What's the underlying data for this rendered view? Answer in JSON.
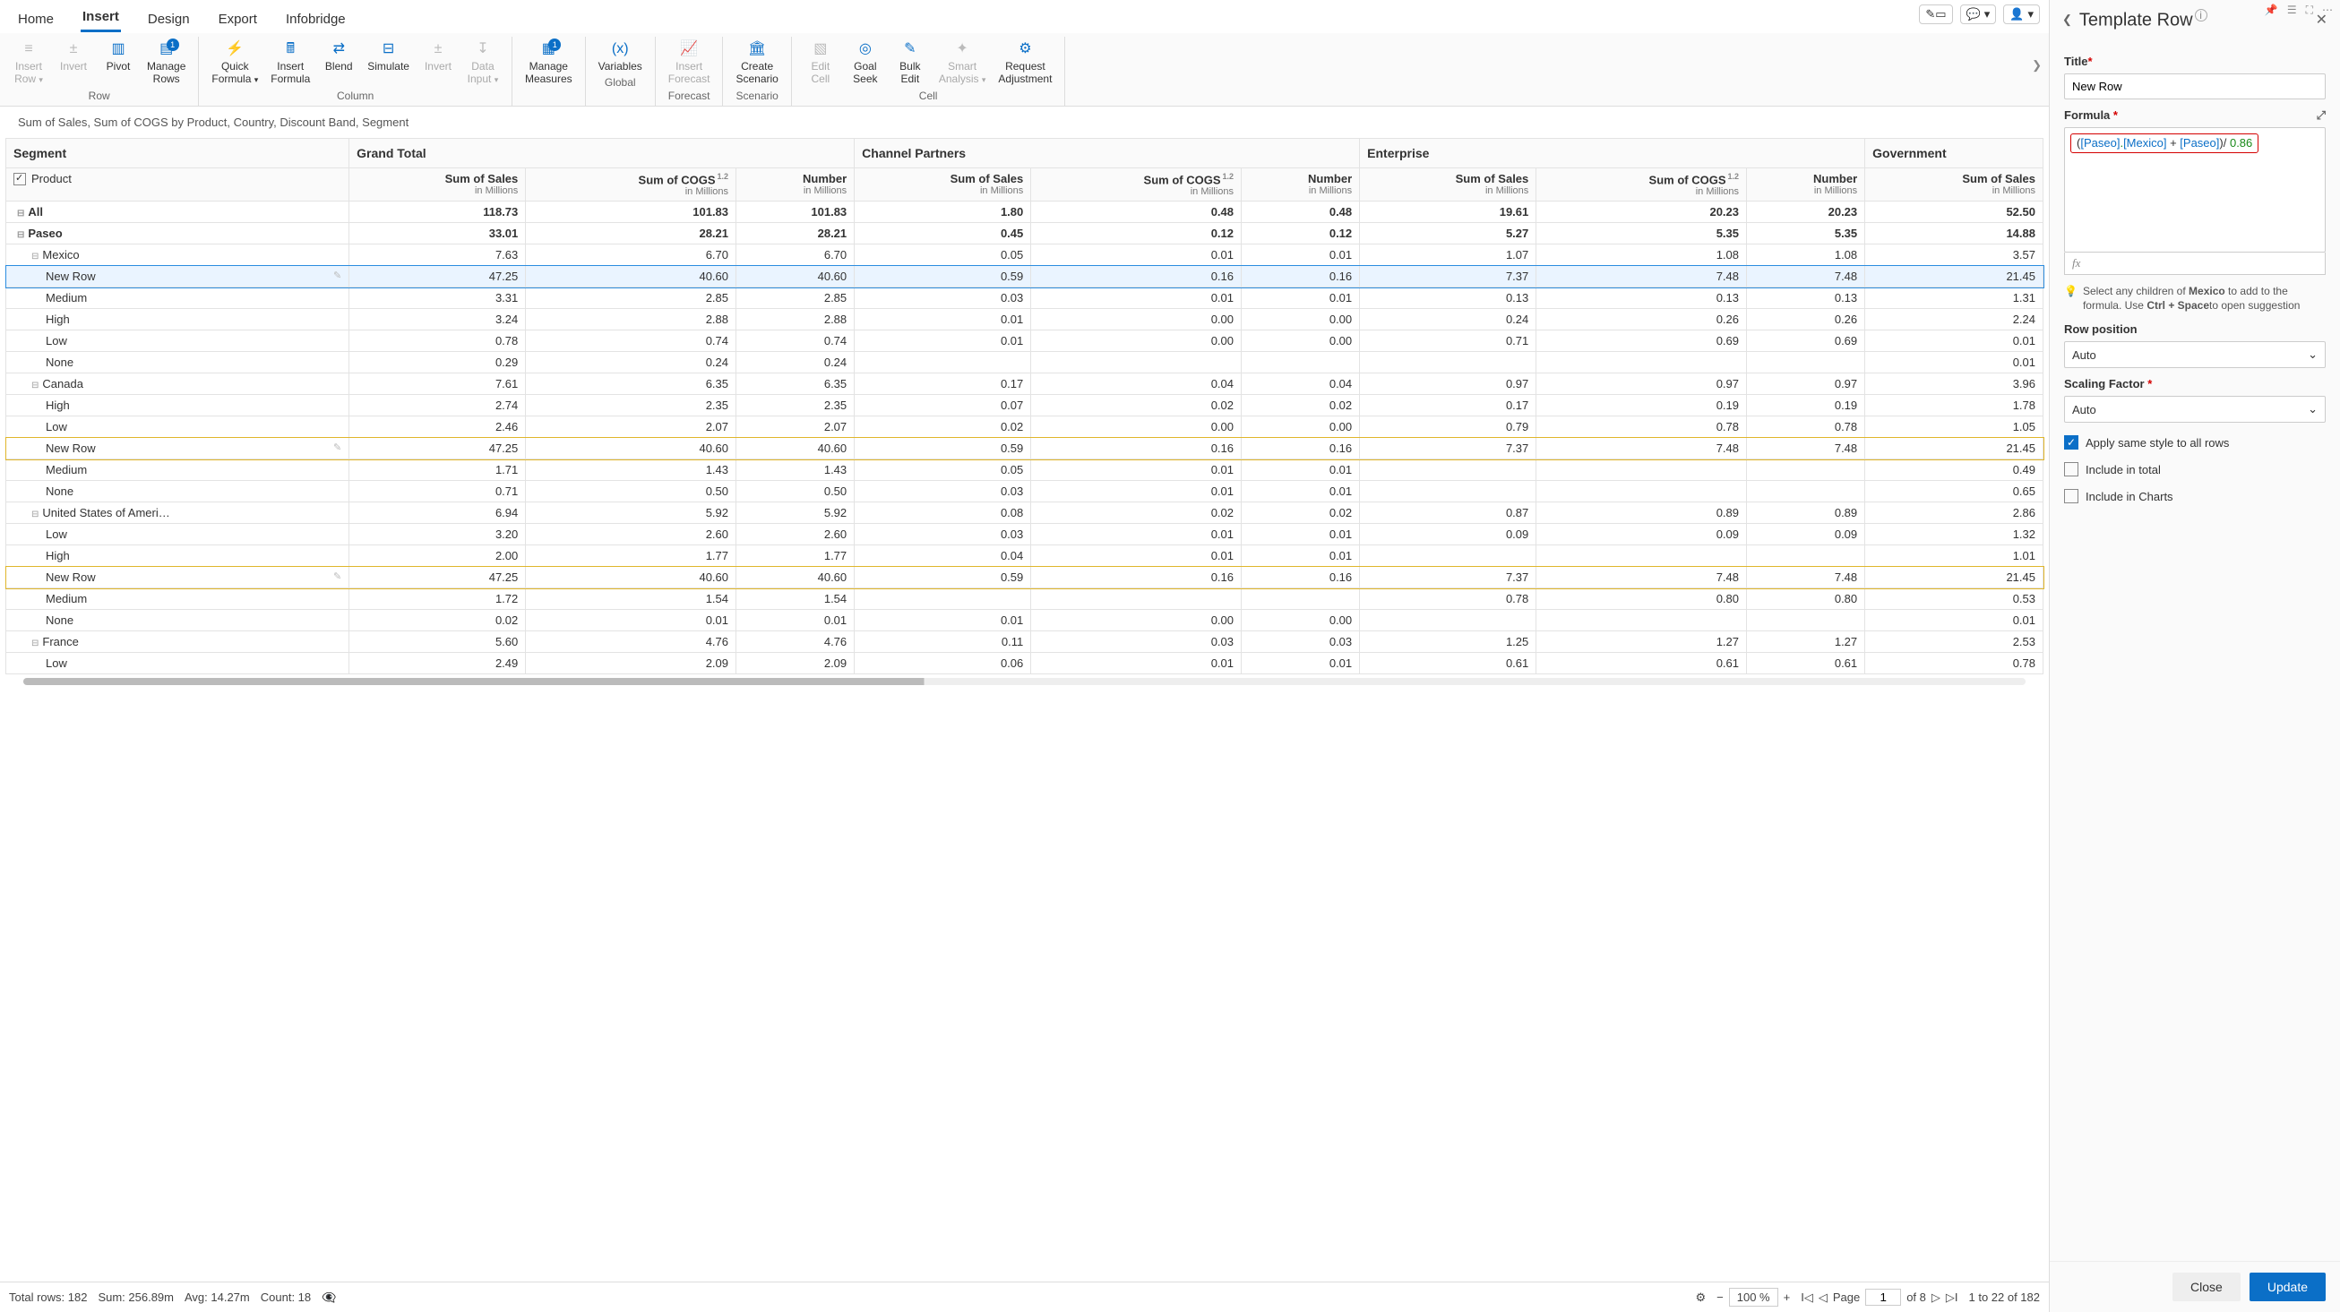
{
  "tabs": [
    "Home",
    "Insert",
    "Design",
    "Export",
    "Infobridge"
  ],
  "active_tab": 1,
  "ribbon_groups": [
    {
      "label": "Row",
      "buttons": [
        {
          "name": "insert-row",
          "label": "Insert\nRow",
          "icon": "≡",
          "disabled": true,
          "chevron": true
        },
        {
          "name": "invert-row",
          "label": "Invert",
          "icon": "±",
          "disabled": true
        },
        {
          "name": "pivot",
          "label": "Pivot",
          "icon": "▥"
        },
        {
          "name": "manage-rows",
          "label": "Manage\nRows",
          "icon": "▤",
          "badge": true
        }
      ]
    },
    {
      "label": "Column",
      "buttons": [
        {
          "name": "quick-formula",
          "label": "Quick\nFormula",
          "icon": "⚡",
          "chevron": true
        },
        {
          "name": "insert-formula",
          "label": "Insert\nFormula",
          "icon": "🖩"
        },
        {
          "name": "blend",
          "label": "Blend",
          "icon": "⇄"
        },
        {
          "name": "simulate",
          "label": "Simulate",
          "icon": "⊟"
        },
        {
          "name": "invert-col",
          "label": "Invert",
          "icon": "±",
          "disabled": true
        },
        {
          "name": "data-input",
          "label": "Data\nInput",
          "icon": "↧",
          "disabled": true,
          "chevron": true
        }
      ]
    },
    {
      "label": "",
      "buttons": [
        {
          "name": "manage-measures",
          "label": "Manage\nMeasures",
          "icon": "▦",
          "badge": true
        }
      ]
    },
    {
      "label": "Global",
      "buttons": [
        {
          "name": "variables",
          "label": "Variables",
          "icon": "(x)"
        }
      ]
    },
    {
      "label": "Forecast",
      "buttons": [
        {
          "name": "insert-forecast",
          "label": "Insert\nForecast",
          "icon": "📈",
          "disabled": true
        }
      ]
    },
    {
      "label": "Scenario",
      "buttons": [
        {
          "name": "create-scenario",
          "label": "Create\nScenario",
          "icon": "🏛"
        }
      ]
    },
    {
      "label": "Cell",
      "buttons": [
        {
          "name": "edit-cell",
          "label": "Edit\nCell",
          "icon": "▧",
          "disabled": true
        },
        {
          "name": "goal-seek",
          "label": "Goal\nSeek",
          "icon": "◎"
        },
        {
          "name": "bulk-edit",
          "label": "Bulk\nEdit",
          "icon": "✎"
        },
        {
          "name": "smart-analysis",
          "label": "Smart\nAnalysis",
          "icon": "✦",
          "disabled": true,
          "chevron": true
        },
        {
          "name": "request-adjustment",
          "label": "Request\nAdjustment",
          "icon": "⚙"
        }
      ]
    }
  ],
  "breadcrumb": "Sum of Sales, Sum of COGS by Product, Country, Discount Band, Segment",
  "segment_header": "Segment",
  "product_header": "Product",
  "column_groups": [
    "Grand Total",
    "Channel Partners",
    "Enterprise",
    "Government"
  ],
  "measure_cols": [
    {
      "main": "Sum of Sales",
      "sub": "in Millions"
    },
    {
      "main": "Sum of COGS",
      "sub": "in Millions",
      "sup": "1.2"
    },
    {
      "main": "Number",
      "sub": "in Millions"
    }
  ],
  "gov_col": {
    "main": "Sum of Sales",
    "sub": "in Millions"
  },
  "rows": [
    {
      "label": "All",
      "indent": 0,
      "bold": true,
      "coll": true,
      "vals": [
        "118.73",
        "101.83",
        "101.83",
        "1.80",
        "0.48",
        "0.48",
        "19.61",
        "20.23",
        "20.23",
        "52.50"
      ]
    },
    {
      "label": "Paseo",
      "indent": 0,
      "bold": true,
      "coll": true,
      "vals": [
        "33.01",
        "28.21",
        "28.21",
        "0.45",
        "0.12",
        "0.12",
        "5.27",
        "5.35",
        "5.35",
        "14.88"
      ]
    },
    {
      "label": "Mexico",
      "indent": 1,
      "coll": true,
      "vals": [
        "7.63",
        "6.70",
        "6.70",
        "0.05",
        "0.01",
        "0.01",
        "1.07",
        "1.08",
        "1.08",
        "3.57"
      ]
    },
    {
      "label": "New Row",
      "indent": 2,
      "pencil": true,
      "rowstyle": "newrow-blue",
      "vals": [
        "47.25",
        "40.60",
        "40.60",
        "0.59",
        "0.16",
        "0.16",
        "7.37",
        "7.48",
        "7.48",
        "21.45"
      ]
    },
    {
      "label": "Medium",
      "indent": 2,
      "vals": [
        "3.31",
        "2.85",
        "2.85",
        "0.03",
        "0.01",
        "0.01",
        "0.13",
        "0.13",
        "0.13",
        "1.31"
      ]
    },
    {
      "label": "High",
      "indent": 2,
      "vals": [
        "3.24",
        "2.88",
        "2.88",
        "0.01",
        "0.00",
        "0.00",
        "0.24",
        "0.26",
        "0.26",
        "2.24"
      ]
    },
    {
      "label": "Low",
      "indent": 2,
      "vals": [
        "0.78",
        "0.74",
        "0.74",
        "0.01",
        "0.00",
        "0.00",
        "0.71",
        "0.69",
        "0.69",
        "0.01"
      ]
    },
    {
      "label": "None",
      "indent": 2,
      "vals": [
        "0.29",
        "0.24",
        "0.24",
        "",
        "",
        "",
        "",
        "",
        "",
        "0.01"
      ]
    },
    {
      "label": "Canada",
      "indent": 1,
      "coll": true,
      "vals": [
        "7.61",
        "6.35",
        "6.35",
        "0.17",
        "0.04",
        "0.04",
        "0.97",
        "0.97",
        "0.97",
        "3.96"
      ]
    },
    {
      "label": "High",
      "indent": 2,
      "vals": [
        "2.74",
        "2.35",
        "2.35",
        "0.07",
        "0.02",
        "0.02",
        "0.17",
        "0.19",
        "0.19",
        "1.78"
      ]
    },
    {
      "label": "Low",
      "indent": 2,
      "vals": [
        "2.46",
        "2.07",
        "2.07",
        "0.02",
        "0.00",
        "0.00",
        "0.79",
        "0.78",
        "0.78",
        "1.05"
      ]
    },
    {
      "label": "New Row",
      "indent": 2,
      "pencil": true,
      "rowstyle": "newrow-yellow",
      "vals": [
        "47.25",
        "40.60",
        "40.60",
        "0.59",
        "0.16",
        "0.16",
        "7.37",
        "7.48",
        "7.48",
        "21.45"
      ]
    },
    {
      "label": "Medium",
      "indent": 2,
      "vals": [
        "1.71",
        "1.43",
        "1.43",
        "0.05",
        "0.01",
        "0.01",
        "",
        "",
        "",
        "0.49"
      ]
    },
    {
      "label": "None",
      "indent": 2,
      "vals": [
        "0.71",
        "0.50",
        "0.50",
        "0.03",
        "0.01",
        "0.01",
        "",
        "",
        "",
        "0.65"
      ]
    },
    {
      "label": "United States of Ameri…",
      "indent": 1,
      "coll": true,
      "vals": [
        "6.94",
        "5.92",
        "5.92",
        "0.08",
        "0.02",
        "0.02",
        "0.87",
        "0.89",
        "0.89",
        "2.86"
      ]
    },
    {
      "label": "Low",
      "indent": 2,
      "vals": [
        "3.20",
        "2.60",
        "2.60",
        "0.03",
        "0.01",
        "0.01",
        "0.09",
        "0.09",
        "0.09",
        "1.32"
      ]
    },
    {
      "label": "High",
      "indent": 2,
      "vals": [
        "2.00",
        "1.77",
        "1.77",
        "0.04",
        "0.01",
        "0.01",
        "",
        "",
        "",
        "1.01"
      ]
    },
    {
      "label": "New Row",
      "indent": 2,
      "pencil": true,
      "rowstyle": "newrow-yellow",
      "vals": [
        "47.25",
        "40.60",
        "40.60",
        "0.59",
        "0.16",
        "0.16",
        "7.37",
        "7.48",
        "7.48",
        "21.45"
      ]
    },
    {
      "label": "Medium",
      "indent": 2,
      "vals": [
        "1.72",
        "1.54",
        "1.54",
        "",
        "",
        "",
        "0.78",
        "0.80",
        "0.80",
        "0.53"
      ]
    },
    {
      "label": "None",
      "indent": 2,
      "vals": [
        "0.02",
        "0.01",
        "0.01",
        "0.01",
        "0.00",
        "0.00",
        "",
        "",
        "",
        "0.01"
      ]
    },
    {
      "label": "France",
      "indent": 1,
      "coll": true,
      "vals": [
        "5.60",
        "4.76",
        "4.76",
        "0.11",
        "0.03",
        "0.03",
        "1.25",
        "1.27",
        "1.27",
        "2.53"
      ]
    },
    {
      "label": "Low",
      "indent": 2,
      "vals": [
        "2.49",
        "2.09",
        "2.09",
        "0.06",
        "0.01",
        "0.01",
        "0.61",
        "0.61",
        "0.61",
        "0.78"
      ]
    }
  ],
  "status": {
    "total_rows": "Total rows: 182",
    "sum": "Sum: 256.89m",
    "avg": "Avg: 14.27m",
    "count": "Count: 18",
    "zoom": "100 %",
    "page_label": "Page",
    "page_cur": "1",
    "page_of": "of 8",
    "range": "1 to 22 of 182"
  },
  "panel": {
    "title": "Template Row",
    "title_label": "Title",
    "title_value": "New Row",
    "formula_label": "Formula",
    "formula_tokens": [
      "(",
      "[Paseo]",
      ".",
      "[Mexico]",
      " + ",
      "[Paseo]",
      ")",
      "/ ",
      "0.86"
    ],
    "fx": "fx",
    "hint_prefix": "Select any children of ",
    "hint_bold": "Mexico",
    "hint_mid": " to add to the formula. Use ",
    "hint_bold2": "Ctrl + Space",
    "hint_suffix": "to open suggestion",
    "rowpos_label": "Row position",
    "rowpos_value": "Auto",
    "scaling_label": "Scaling Factor",
    "scaling_value": "Auto",
    "chk_style": "Apply same style to all rows",
    "chk_total": "Include in total",
    "chk_charts": "Include in Charts",
    "btn_close": "Close",
    "btn_update": "Update"
  }
}
